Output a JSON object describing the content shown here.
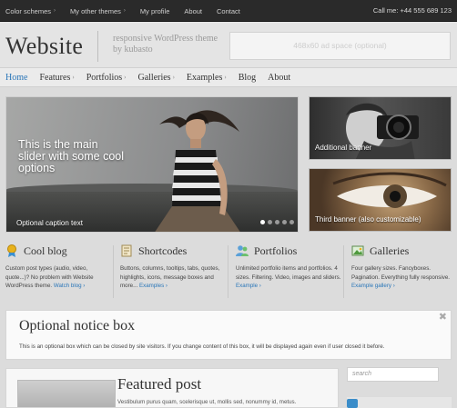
{
  "topbar": {
    "links": [
      "Color schemes",
      "My other themes",
      "My profile",
      "About",
      "Contact"
    ],
    "phone": "Call me: +44 555 689 123"
  },
  "header": {
    "logo": "Website",
    "tagline": "responsive WordPress theme by kubasto",
    "ad_space": "468x60 ad space (optional)"
  },
  "nav": {
    "items": [
      {
        "label": "Home",
        "active": true,
        "submenu": false
      },
      {
        "label": "Features",
        "active": false,
        "submenu": true
      },
      {
        "label": "Portfolios",
        "active": false,
        "submenu": true
      },
      {
        "label": "Galleries",
        "active": false,
        "submenu": true
      },
      {
        "label": "Examples",
        "active": false,
        "submenu": true
      },
      {
        "label": "Blog",
        "active": false,
        "submenu": false
      },
      {
        "label": "About",
        "active": false,
        "submenu": false
      }
    ]
  },
  "slider": {
    "caption_main": "This is the main slider with some cool options",
    "caption_sub": "Optional caption text",
    "dot_count": 5,
    "active_dot": 1
  },
  "banners": {
    "first": "Additional banner",
    "second": "Third banner (also customizable)"
  },
  "features": [
    {
      "title": "Cool blog",
      "icon": "medal-icon",
      "text": "Custom post types (audio, video, quote...)? No problem with Website WordPress theme.",
      "link": "Watch blog ›"
    },
    {
      "title": "Shortcodes",
      "icon": "document-icon",
      "text": "Buttons, columns, tooltips, tabs, quotes, highlights, icons, message boxes and more...",
      "link": "Examples ›"
    },
    {
      "title": "Portfolios",
      "icon": "people-icon",
      "text": "Unlimited portfolio items and portfolios. 4 sizes. Filtering. Video, images and sliders.",
      "link": "Example ›"
    },
    {
      "title": "Galleries",
      "icon": "picture-icon",
      "text": "Four gallery sizes. Fancyboxes. Pagination. Everything fully responsive.",
      "link": "Example gallery ›"
    }
  ],
  "notice": {
    "title": "Optional notice box",
    "text": "This is an optional box which can be closed by site visitors. If you change content of this box, it will be displayed again even if user closed it before.",
    "close": "✖"
  },
  "featured": {
    "title": "Featured post",
    "text": "Vestibulum purus quam, scelerisque ut, mollis sed, nonummy id, metus."
  },
  "search": {
    "placeholder": "search"
  },
  "colors": {
    "link": "#2a76b8",
    "topbar": "#2a2a2a"
  }
}
